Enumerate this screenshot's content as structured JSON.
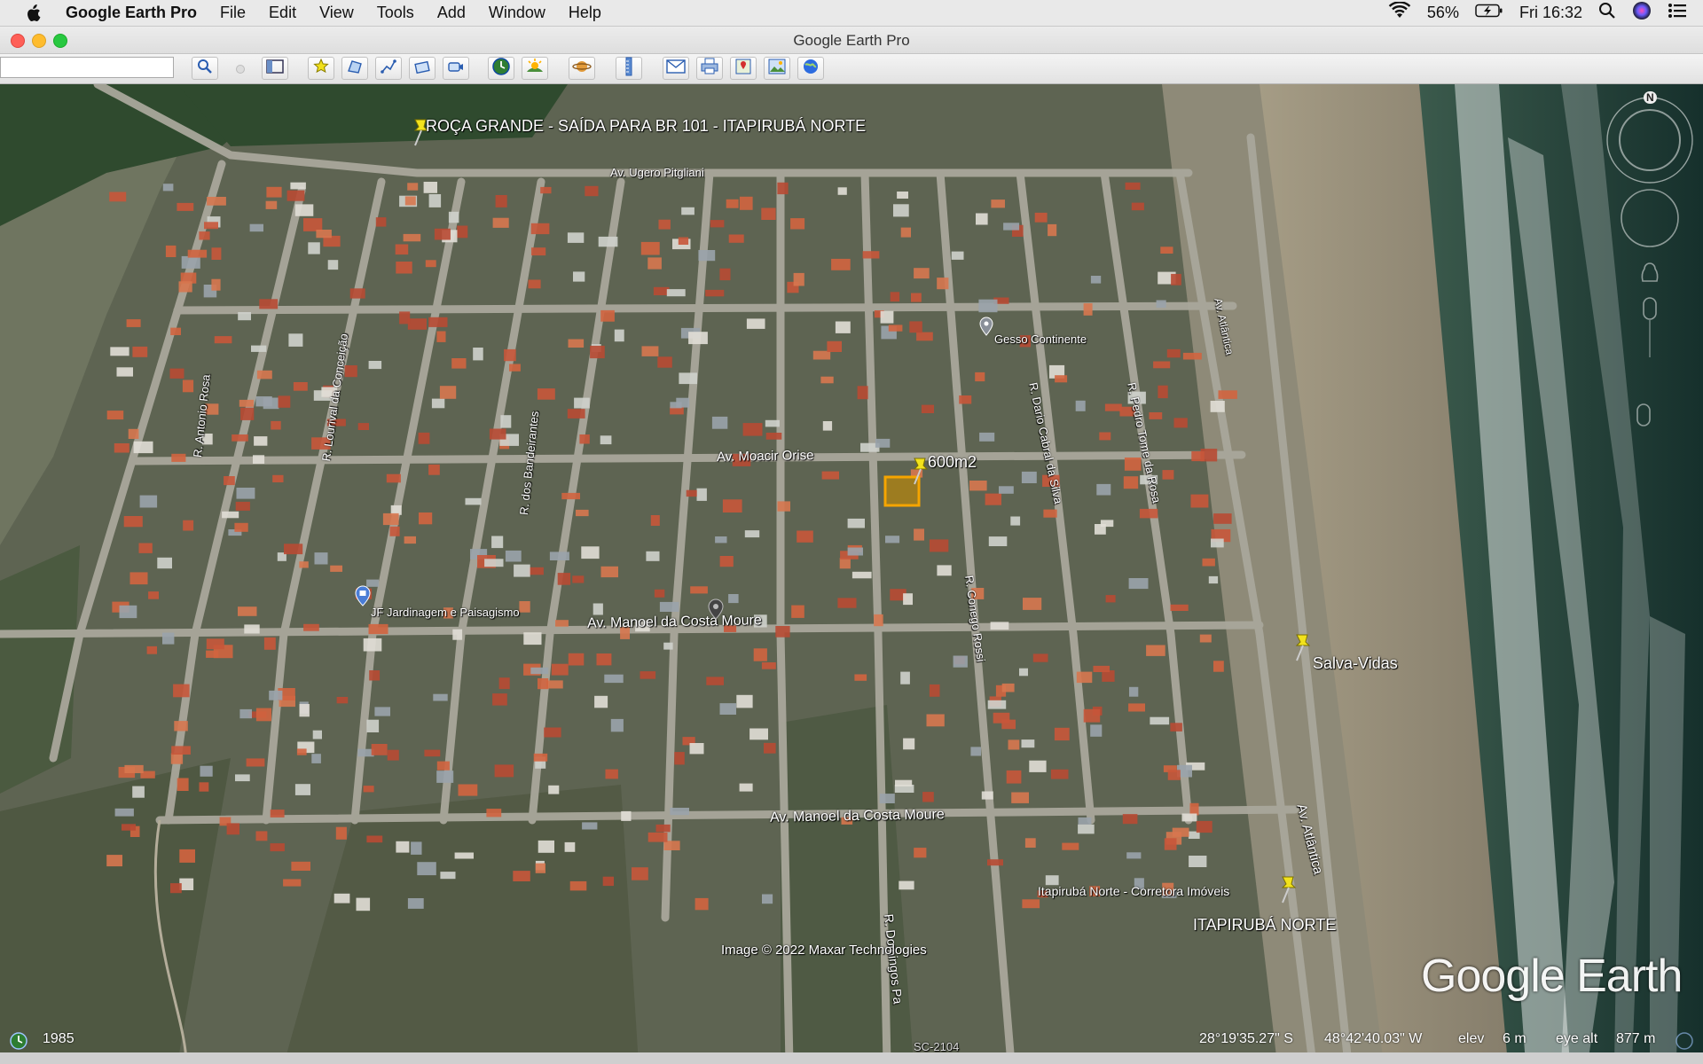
{
  "menubar": {
    "app_name": "Google Earth Pro",
    "menus": [
      "File",
      "Edit",
      "View",
      "Tools",
      "Add",
      "Window",
      "Help"
    ],
    "battery": "56%",
    "clock": "Fri 16:32"
  },
  "window": {
    "title": "Google Earth Pro"
  },
  "search": {
    "value": ""
  },
  "map": {
    "placemarks": {
      "roca_grande": "ROÇA GRANDE - SAÍDA PARA BR 101 - ITAPIRUBÁ NORTE",
      "lot": "600m2",
      "salva_vidas": "Salva-Vidas",
      "itapiruba_norte": "ITAPIRUBÁ NORTE"
    },
    "streets": {
      "ugero": "Av. Ugero Pitgliani",
      "moacir": "Av. Moacir Orise",
      "manoel_1": "Av. Manoel da Costa Moure",
      "manoel_2": "Av. Manoel da Costa Moure",
      "antonio_rosa": "R. Antonio Rosa",
      "lourival": "R. Lourival da Conceição",
      "bandeirantes": "R. dos Bandeirantes",
      "dario": "R. Dario Cabral da Silva",
      "pedro": "R. Pedro Tome da Rosa",
      "conego": "R. Conego Rossi",
      "domingos": "R. Domingos Pa",
      "atlantica_1": "Av. Atlântica",
      "atlantica_2": "Av. Atlântica",
      "sc": "SC-2104"
    },
    "pois": {
      "gesso": "Gesso Continente",
      "jf": "JF Jardinagem e Paisagismo",
      "corretora": "Itapirubá Norte - Corretora Imóveis"
    },
    "copyright": "Image © 2022 Maxar Technologies",
    "logo": "Google Earth",
    "compass_north": "N"
  },
  "status": {
    "year": "1985",
    "lat": "28°19'35.27\" S",
    "lon": "48°42'40.03\" W",
    "elev_label": "elev",
    "elev_value": "6 m",
    "eye_label": "eye alt",
    "eye_value": "877 m"
  },
  "colors": {
    "pin": "#f2e21c",
    "lot_fill": "#b8860b",
    "water": "#2d4a3e"
  }
}
